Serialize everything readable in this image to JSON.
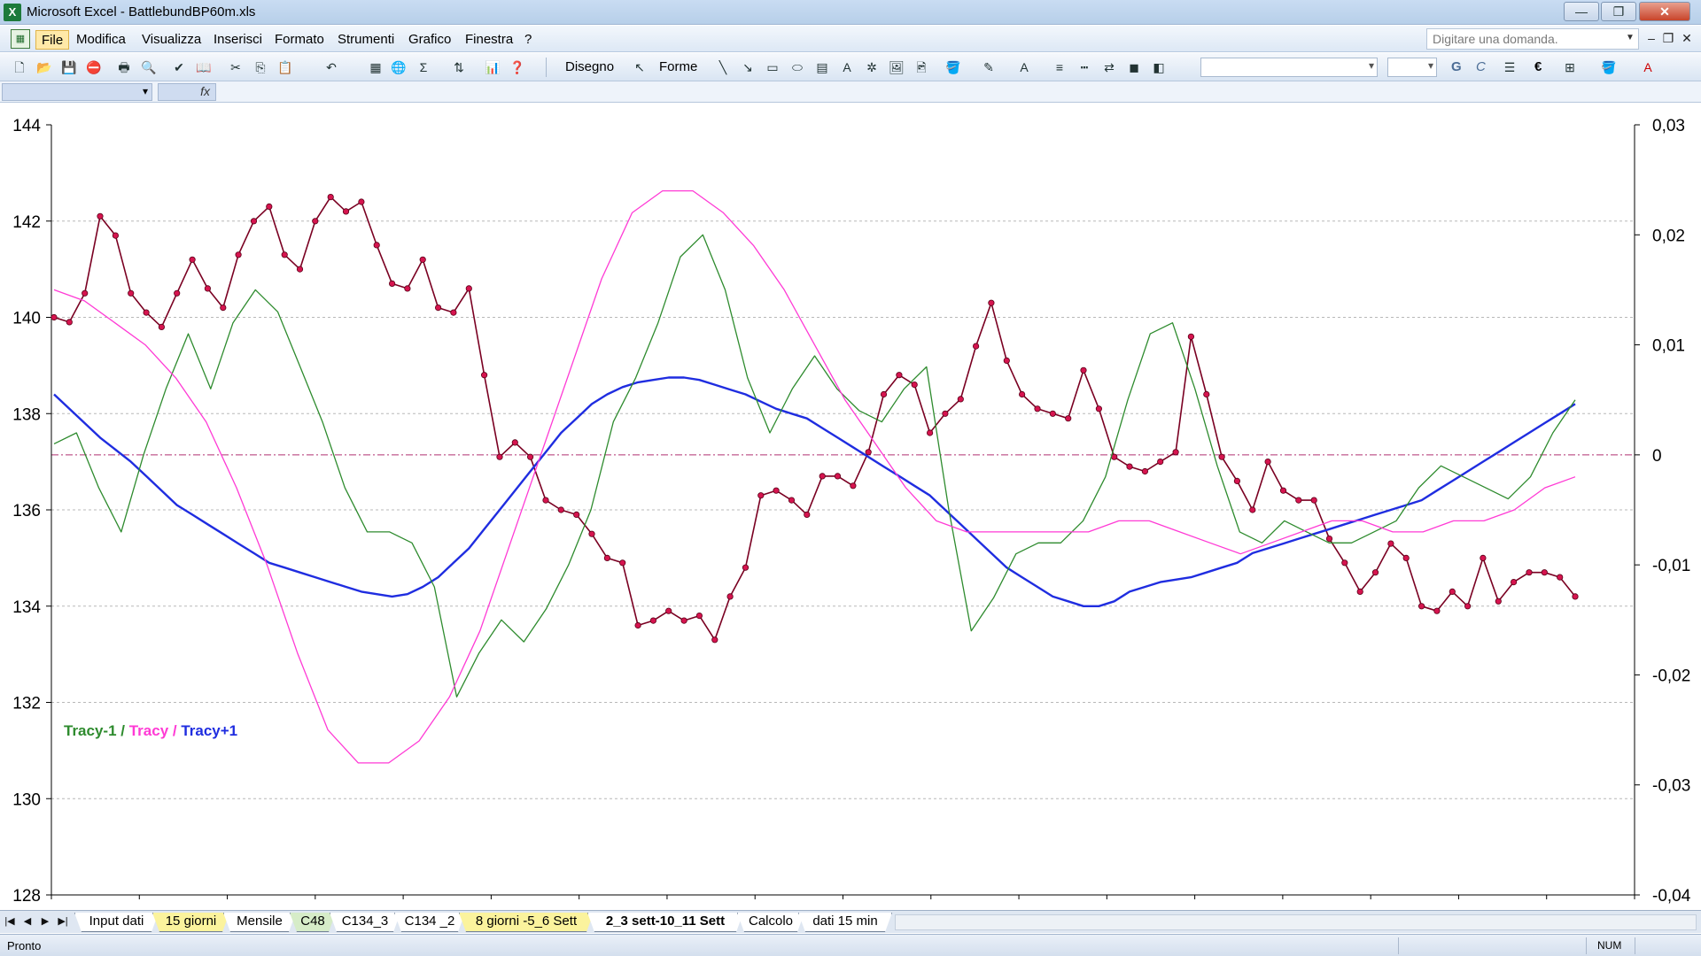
{
  "window": {
    "title": "Microsoft Excel - BattlebundBP60m.xls",
    "app_icon": "excel-icon",
    "controls": {
      "minimize": "—",
      "restore": "❐",
      "close": "✕"
    }
  },
  "menu": {
    "items": [
      "File",
      "Modifica",
      "Visualizza",
      "Inserisci",
      "Formato",
      "Strumenti",
      "Grafico",
      "Finestra",
      "?"
    ],
    "ask_placeholder": "Digitare una domanda."
  },
  "toolbar": {
    "disegno_label": "Disegno",
    "forme_label": "Forme",
    "bold_label": "G",
    "cursive_label": "C",
    "euro_label": "€"
  },
  "formula": {
    "fx_label": "fx"
  },
  "chart_data": {
    "type": "line",
    "legend": {
      "placement": "bottom-left",
      "entries": [
        {
          "text": "Tracy-1",
          "color": "#2e8b2e"
        },
        {
          "text": " / ",
          "color": "#2e8b2e"
        },
        {
          "text": "Tracy",
          "color": "#ff3ad5"
        },
        {
          "text": " / ",
          "color": "#ff3ad5"
        },
        {
          "text": "Tracy+1",
          "color": "#1f2de0"
        }
      ]
    },
    "y_left": {
      "min": 128,
      "max": 144,
      "ticks": [
        "144",
        "142",
        "140",
        "138",
        "136",
        "134",
        "132",
        "130",
        "128"
      ]
    },
    "y_right": {
      "min": -0.04,
      "max": 0.03,
      "ticks": [
        "0,03",
        "0,02",
        "0,01",
        "0",
        "-0,01",
        "-0,02",
        "-0,03",
        "-0,04"
      ]
    },
    "grid": true,
    "x_count": 100,
    "series": [
      {
        "axis": "left",
        "color": "#7a0022",
        "marker_color": "#d6144f",
        "markers": true,
        "values": [
          140,
          139.9,
          140.5,
          142.1,
          141.7,
          140.5,
          140.1,
          139.8,
          140.5,
          141.2,
          140.6,
          140.2,
          141.3,
          142,
          142.3,
          141.3,
          141,
          142,
          142.5,
          142.2,
          142.4,
          141.5,
          140.7,
          140.6,
          141.2,
          140.2,
          140.1,
          140.6,
          138.8,
          137.1,
          137.4,
          137.1,
          136.2,
          136,
          135.9,
          135.5,
          135,
          134.9,
          133.6,
          133.7,
          133.9,
          133.7,
          133.8,
          133.3,
          134.2,
          134.8,
          136.3,
          136.4,
          136.2,
          135.9,
          136.7,
          136.7,
          136.5,
          137.2,
          138.4,
          138.8,
          138.6,
          137.6,
          138,
          138.3,
          139.4,
          140.3,
          139.1,
          138.4,
          138.1,
          138,
          137.9,
          138.9,
          138.1,
          137.1,
          136.9,
          136.8,
          137,
          137.2,
          139.6,
          138.4,
          137.1,
          136.6,
          136,
          137,
          136.4,
          136.2,
          136.2,
          135.4,
          134.9,
          134.3,
          134.7,
          135.3,
          135,
          134,
          133.9,
          134.3,
          134,
          135,
          134.1,
          134.5,
          134.7,
          134.7,
          134.6,
          134.2
        ]
      },
      {
        "axis": "left",
        "color": "#1f2de0",
        "markers": false,
        "values": [
          138.4,
          138.1,
          137.8,
          137.5,
          137.25,
          137,
          136.7,
          136.4,
          136.1,
          135.9,
          135.7,
          135.5,
          135.3,
          135.1,
          134.9,
          134.8,
          134.7,
          134.6,
          134.5,
          134.4,
          134.3,
          134.25,
          134.2,
          134.25,
          134.4,
          134.6,
          134.9,
          135.2,
          135.6,
          136,
          136.4,
          136.8,
          137.2,
          137.6,
          137.9,
          138.2,
          138.4,
          138.55,
          138.65,
          138.7,
          138.75,
          138.75,
          138.7,
          138.6,
          138.5,
          138.4,
          138.25,
          138.1,
          138,
          137.9,
          137.7,
          137.5,
          137.3,
          137.1,
          136.9,
          136.7,
          136.5,
          136.3,
          136,
          135.7,
          135.4,
          135.1,
          134.8,
          134.6,
          134.4,
          134.2,
          134.1,
          134,
          134,
          134.1,
          134.3,
          134.4,
          134.5,
          134.55,
          134.6,
          134.7,
          134.8,
          134.9,
          135.1,
          135.2,
          135.3,
          135.4,
          135.5,
          135.6,
          135.7,
          135.8,
          135.9,
          136,
          136.1,
          136.2,
          136.4,
          136.6,
          136.8,
          137,
          137.2,
          137.4,
          137.6,
          137.8,
          138,
          138.2
        ]
      },
      {
        "axis": "right",
        "color": "#2e8b2e",
        "markers": false,
        "values": [
          0.001,
          0.002,
          -0.003,
          -0.007,
          0,
          0.006,
          0.011,
          0.006,
          0.012,
          0.015,
          0.013,
          0.008,
          0.003,
          -0.003,
          -0.007,
          -0.007,
          -0.008,
          -0.012,
          -0.022,
          -0.018,
          -0.015,
          -0.017,
          -0.014,
          -0.01,
          -0.005,
          0.003,
          0.007,
          0.012,
          0.018,
          0.02,
          0.015,
          0.007,
          0.002,
          0.006,
          0.009,
          0.006,
          0.004,
          0.003,
          0.006,
          0.008,
          -0.005,
          -0.016,
          -0.013,
          -0.009,
          -0.008,
          -0.008,
          -0.006,
          -0.002,
          0.005,
          0.011,
          0.012,
          0.006,
          -0.001,
          -0.007,
          -0.008,
          -0.006,
          -0.007,
          -0.008,
          -0.008,
          -0.007,
          -0.006,
          -0.003,
          -0.001,
          -0.002,
          -0.003,
          -0.004,
          -0.002,
          0.002,
          0.005
        ]
      },
      {
        "axis": "right",
        "color": "#ff3ad5",
        "markers": false,
        "values": [
          0.015,
          0.014,
          0.012,
          0.01,
          0.007,
          0.003,
          -0.003,
          -0.01,
          -0.018,
          -0.025,
          -0.028,
          -0.028,
          -0.026,
          -0.022,
          -0.016,
          -0.008,
          0,
          0.008,
          0.016,
          0.022,
          0.024,
          0.024,
          0.022,
          0.019,
          0.015,
          0.01,
          0.005,
          0.001,
          -0.003,
          -0.006,
          -0.007,
          -0.007,
          -0.007,
          -0.007,
          -0.007,
          -0.006,
          -0.006,
          -0.007,
          -0.008,
          -0.009,
          -0.008,
          -0.007,
          -0.006,
          -0.006,
          -0.007,
          -0.007,
          -0.006,
          -0.006,
          -0.005,
          -0.003,
          -0.002
        ]
      }
    ]
  },
  "sheets": {
    "tabs": [
      "Input dati",
      "15 giorni",
      "Mensile",
      "C48",
      "C134_3",
      "C134 _2",
      "8 giorni -5_6 Sett",
      "2_3 sett-10_11 Sett",
      "Calcolo",
      "dati 15 min"
    ],
    "active": "2_3 sett-10_11 Sett"
  },
  "status": {
    "text": "Pronto",
    "num": "NUM"
  }
}
